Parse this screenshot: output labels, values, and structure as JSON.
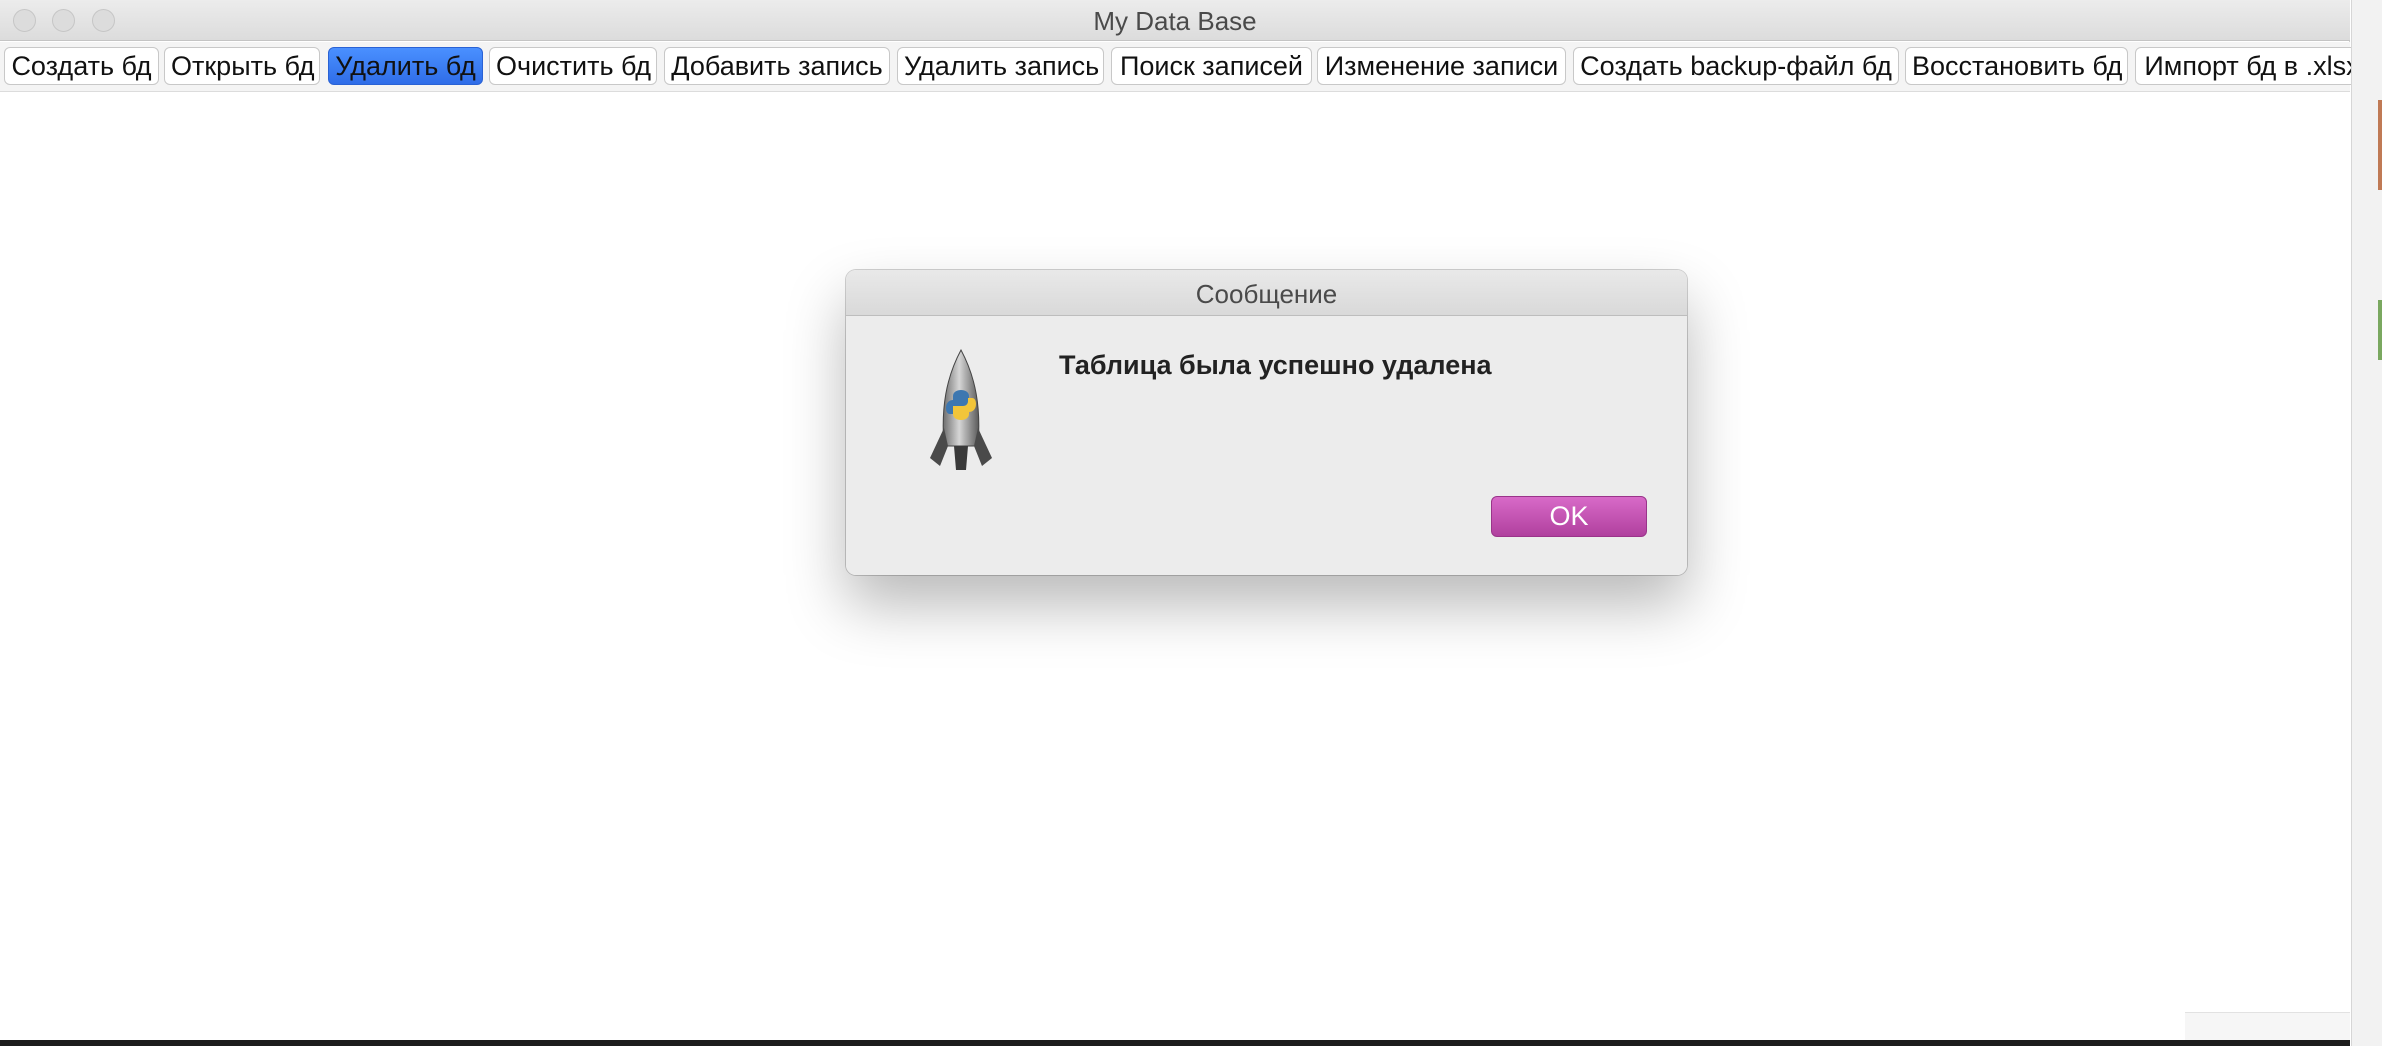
{
  "window": {
    "title": "My Data Base"
  },
  "toolbar": {
    "buttons": [
      {
        "label": "Создать бд"
      },
      {
        "label": "Открыть бд"
      },
      {
        "label": "Удалить бд"
      },
      {
        "label": "Очистить бд"
      },
      {
        "label": "Добавить запись"
      },
      {
        "label": "Удалить запись"
      },
      {
        "label": "Поиск записей"
      },
      {
        "label": "Изменение записи"
      },
      {
        "label": "Создать backup-файл бд"
      },
      {
        "label": "Восстановить бд"
      },
      {
        "label": "Импорт бд в .xlsx"
      }
    ],
    "active_button": "Удалить бд"
  },
  "dialog": {
    "title": "Сообщение",
    "message": "Таблица была успешно удалена",
    "icon": "python-launcher-rocket-icon",
    "ok_label": "OK"
  },
  "colors": {
    "active_button": "#2f6de8",
    "ok_button": "#c355b2"
  }
}
